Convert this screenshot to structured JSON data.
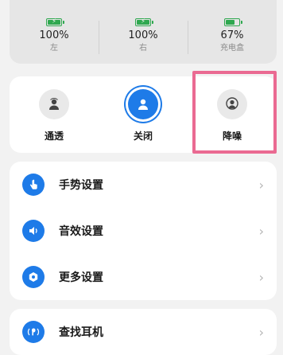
{
  "battery": [
    {
      "percent": "100%",
      "label": "左",
      "level": 1.0,
      "charging": true
    },
    {
      "percent": "100%",
      "label": "右",
      "level": 1.0,
      "charging": true
    },
    {
      "percent": "67%",
      "label": "充电盒",
      "level": 0.67,
      "charging": false
    }
  ],
  "anc_modes": [
    {
      "label": "通透",
      "icon": "transparency-icon",
      "active": false
    },
    {
      "label": "关闭",
      "icon": "anc-off-icon",
      "active": true
    },
    {
      "label": "降噪",
      "icon": "noise-cancel-icon",
      "active": false
    }
  ],
  "menu": [
    {
      "label": "手势设置",
      "icon": "gesture-icon"
    },
    {
      "label": "音效设置",
      "icon": "sound-effect-icon"
    },
    {
      "label": "更多设置",
      "icon": "more-settings-icon"
    }
  ],
  "find": {
    "label": "查找耳机",
    "icon": "find-earbuds-icon"
  },
  "colors": {
    "accent": "#1e7be8",
    "battery": "#2fa84f",
    "highlight": "#ea6a92"
  }
}
